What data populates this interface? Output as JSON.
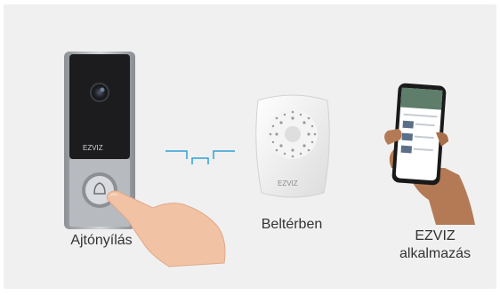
{
  "labels": {
    "doorbell": "Ajtónyílás",
    "chime": "Beltérben",
    "app_line1": "EZVIZ",
    "app_line2": "alkalmazás"
  },
  "brand": {
    "logo_doorbell": "EZVIZ",
    "logo_chime": "EZVIZ"
  },
  "colors": {
    "background": "#f0f0f0",
    "signal": "#2f9fd8",
    "doorbell_body": "#1c1c1e",
    "doorbell_button_panel": "#b9bcc0"
  }
}
